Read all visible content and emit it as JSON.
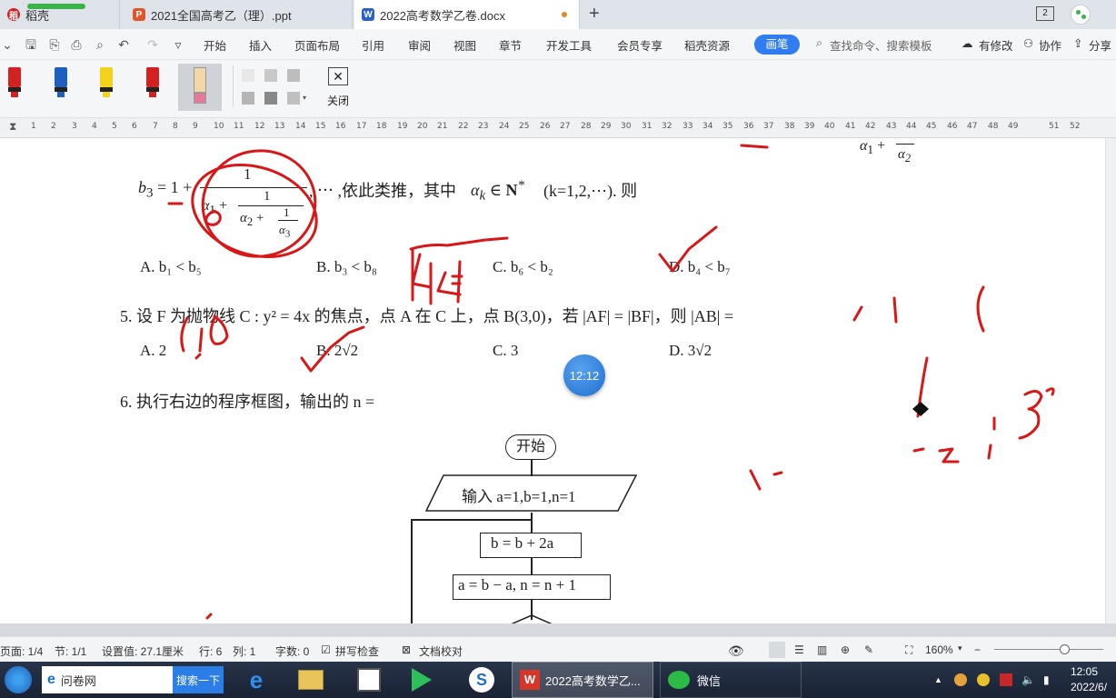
{
  "tabs": [
    {
      "label": "稻壳",
      "icon": "daoke-logo-icon"
    },
    {
      "label": "2021全国高考乙（理）.ppt",
      "icon": "ppt-file-icon"
    },
    {
      "label": "2022高考数学乙卷.docx",
      "icon": "word-file-icon"
    }
  ],
  "tab_new": "+",
  "tab_count": "2",
  "menu": {
    "items": [
      "开始",
      "插入",
      "页面布局",
      "引用",
      "审阅",
      "视图",
      "章节",
      "开发工具",
      "会员专享",
      "稻壳资源"
    ],
    "active": "画笔",
    "search": "查找命令、搜索模板",
    "right": [
      "有修改",
      "协作",
      "分享"
    ]
  },
  "pen": {
    "close_label": "关闭",
    "colors": [
      "#d42020",
      "#1f5fbf",
      "#f2d21b",
      "#d42020"
    ]
  },
  "ruler": [
    "1",
    "2",
    "3",
    "4",
    "5",
    "6",
    "7",
    "8",
    "9",
    "10",
    "11",
    "12",
    "13",
    "14",
    "15",
    "16",
    "17",
    "18",
    "19",
    "20",
    "21",
    "22",
    "23",
    "24",
    "25",
    "26",
    "27",
    "28",
    "29",
    "30",
    "31",
    "32",
    "33",
    "34",
    "35",
    "36",
    "37",
    "38",
    "39",
    "40",
    "41",
    "42",
    "43",
    "44",
    "45",
    "46",
    "47",
    "48",
    "49",
    "51",
    "52"
  ],
  "doc": {
    "q4_tail": ", ⋯ ,依此类推，其中",
    "q4_cond": "(k=1,2,⋯). 则",
    "q4_opts": [
      "A. b₁ < b₅",
      "B. b₃ < b₈",
      "C. b₆ < b₂",
      "D. b₄ < b₇"
    ],
    "q5_text": "5.  设 F 为抛物线 C : y² = 4x 的焦点，点 A 在 C 上，点 B(3,0)，若 |AF| = |BF|，则 |AB| =",
    "q5_opts": [
      "A. 2",
      "B. 2√2",
      "C. 3",
      "D. 3√2"
    ],
    "q6_text": "6. 执行右边的程序框图，输出的 n =",
    "flow": {
      "start": "开始",
      "input": "输入 a=1,b=1,n=1",
      "step1": "b = b + 2a",
      "step2": "a = b − a, n = n + 1"
    },
    "timer": "12:12"
  },
  "status": {
    "page": "页面: 1/4",
    "section": "节: 1/1",
    "setting": "设置值: 27.1厘米",
    "row": "行: 6",
    "col": "列: 1",
    "words": "字数: 0",
    "spell": "拼写检查",
    "proof": "文档校对",
    "zoom": "160%"
  },
  "taskbar": {
    "ie_label": "问卷网",
    "search_btn": "搜索一下",
    "word_task": "2022高考数学乙...",
    "wechat": "微信",
    "time": "12:05",
    "date": "2022/6/"
  }
}
